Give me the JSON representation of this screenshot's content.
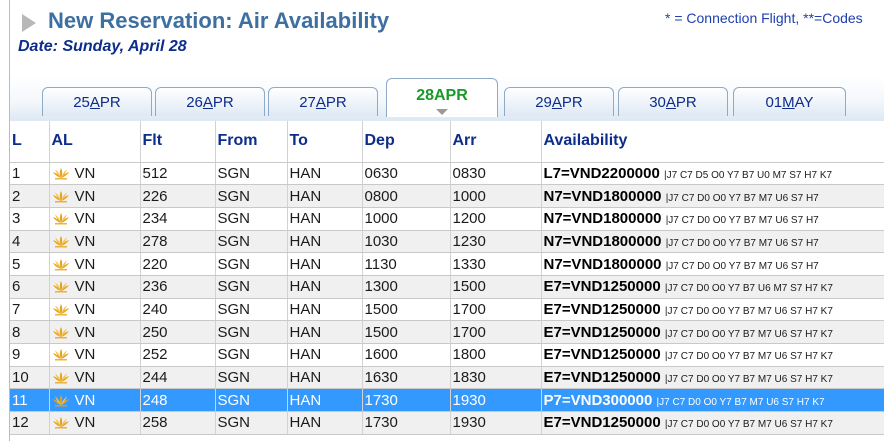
{
  "header": {
    "title": "New Reservation: Air Availability",
    "note": "* = Connection Flight, **=Codes",
    "date": "Date: Sunday, April 28"
  },
  "tabs": [
    {
      "pre": "25",
      "ul": "A",
      "post": "PR",
      "active": false
    },
    {
      "pre": "26",
      "ul": "A",
      "post": "PR",
      "active": false
    },
    {
      "pre": "27",
      "ul": "A",
      "post": "PR",
      "active": false
    },
    {
      "pre": "28APR",
      "ul": "",
      "post": "",
      "active": true
    },
    {
      "pre": "29",
      "ul": "A",
      "post": "PR",
      "active": false
    },
    {
      "pre": "30",
      "ul": "A",
      "post": "PR",
      "active": false
    },
    {
      "pre": "01",
      "ul": "M",
      "post": "AY",
      "active": false
    }
  ],
  "columns": [
    "L",
    "AL",
    "Flt",
    "From",
    "To",
    "Dep",
    "Arr",
    "Availability"
  ],
  "flights": [
    {
      "l": "1",
      "al": "VN",
      "flt": "512",
      "from": "SGN",
      "to": "HAN",
      "dep": "0630",
      "arr": "0830",
      "fare": "L7=VND2200000",
      "classes": "|J7 C7 D5 O0 Y7 B7 U0 M7 S7 H7 K7"
    },
    {
      "l": "2",
      "al": "VN",
      "flt": "226",
      "from": "SGN",
      "to": "HAN",
      "dep": "0800",
      "arr": "1000",
      "fare": "N7=VND1800000",
      "classes": "|J7 C7 D0 O0 Y7 B7 M7 U6 S7 H7"
    },
    {
      "l": "3",
      "al": "VN",
      "flt": "234",
      "from": "SGN",
      "to": "HAN",
      "dep": "1000",
      "arr": "1200",
      "fare": "N7=VND1800000",
      "classes": "|J7 C7 D0 O0 Y7 B7 M7 U6 S7 H7"
    },
    {
      "l": "4",
      "al": "VN",
      "flt": "278",
      "from": "SGN",
      "to": "HAN",
      "dep": "1030",
      "arr": "1230",
      "fare": "N7=VND1800000",
      "classes": "|J7 C7 D0 O0 Y7 B7 M7 U6 S7 H7"
    },
    {
      "l": "5",
      "al": "VN",
      "flt": "220",
      "from": "SGN",
      "to": "HAN",
      "dep": "1130",
      "arr": "1330",
      "fare": "N7=VND1800000",
      "classes": "|J7 C7 D0 O0 Y7 B7 M7 U6 S7 H7"
    },
    {
      "l": "6",
      "al": "VN",
      "flt": "236",
      "from": "SGN",
      "to": "HAN",
      "dep": "1300",
      "arr": "1500",
      "fare": "E7=VND1250000",
      "classes": "|J7 C7 D0 O0 Y7 B7 U6 M7 S7 H7 K7"
    },
    {
      "l": "7",
      "al": "VN",
      "flt": "240",
      "from": "SGN",
      "to": "HAN",
      "dep": "1500",
      "arr": "1700",
      "fare": "E7=VND1250000",
      "classes": "|J7 C7 D0 O0 Y7 B7 M7 U6 S7 H7 K7"
    },
    {
      "l": "8",
      "al": "VN",
      "flt": "250",
      "from": "SGN",
      "to": "HAN",
      "dep": "1500",
      "arr": "1700",
      "fare": "E7=VND1250000",
      "classes": "|J7 C7 D0 O0 Y7 B7 M7 U6 S7 H7 K7"
    },
    {
      "l": "9",
      "al": "VN",
      "flt": "252",
      "from": "SGN",
      "to": "HAN",
      "dep": "1600",
      "arr": "1800",
      "fare": "E7=VND1250000",
      "classes": "|J7 C7 D0 O0 Y7 B7 M7 U6 S7 H7 K7"
    },
    {
      "l": "10",
      "al": "VN",
      "flt": "244",
      "from": "SGN",
      "to": "HAN",
      "dep": "1630",
      "arr": "1830",
      "fare": "E7=VND1250000",
      "classes": "|J7 C7 D0 O0 Y7 B7 M7 U6 S7 H7 K7"
    },
    {
      "l": "11",
      "al": "VN",
      "flt": "248",
      "from": "SGN",
      "to": "HAN",
      "dep": "1730",
      "arr": "1930",
      "fare": "P7=VND300000",
      "classes": "|J7 C7 D0 O0 Y7 B7 M7 U6 S7 H7 K7",
      "selected": true
    },
    {
      "l": "12",
      "al": "VN",
      "flt": "258",
      "from": "SGN",
      "to": "HAN",
      "dep": "1730",
      "arr": "1930",
      "fare": "E7=VND1250000",
      "classes": "|J7 C7 D0 O0 Y7 B7 M7 U6 S7 H7 K7"
    }
  ],
  "airline_logo_icon": "lotus-icon",
  "colors": {
    "title": "#3d6fa0",
    "active_tab": "#1a9a2a",
    "selected_row": "#3399ff",
    "link": "#0d2d8a"
  }
}
